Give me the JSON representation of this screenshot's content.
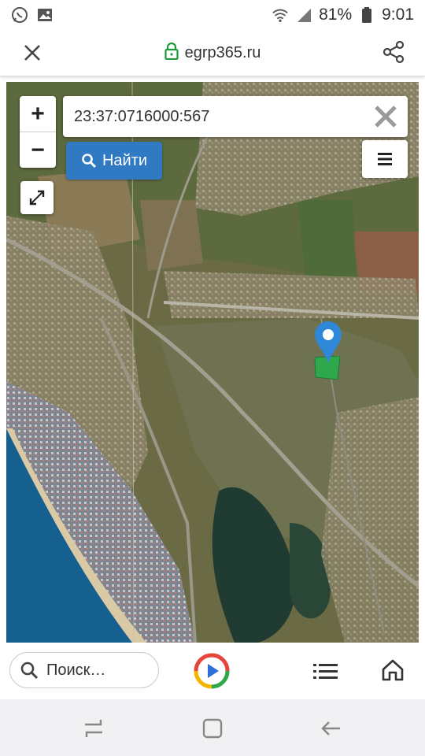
{
  "status_bar": {
    "left_icons": [
      "whatsapp-icon",
      "image-icon"
    ],
    "battery": "81%",
    "time": "9:01",
    "right_icons": [
      "wifi-icon",
      "cell-signal-icon",
      "battery-icon"
    ]
  },
  "browser": {
    "url": "egrp365.ru",
    "close_icon": "close-icon",
    "secure_icon": "lock-icon",
    "share_icon": "share-icon"
  },
  "map": {
    "search_value": "23:37:0716000:567",
    "find_label": "Найти",
    "zoom_in": "+",
    "zoom_out": "−",
    "pin_color": "#2f87d8",
    "parcel_color": "#2ea84a"
  },
  "bottom_bar": {
    "search_placeholder": "Поиск…",
    "icons": [
      "search-icon",
      "play-icon",
      "list-icon",
      "home-icon"
    ]
  },
  "nav_bar": {
    "icons": [
      "recent-apps-icon",
      "home-icon",
      "back-icon"
    ]
  }
}
